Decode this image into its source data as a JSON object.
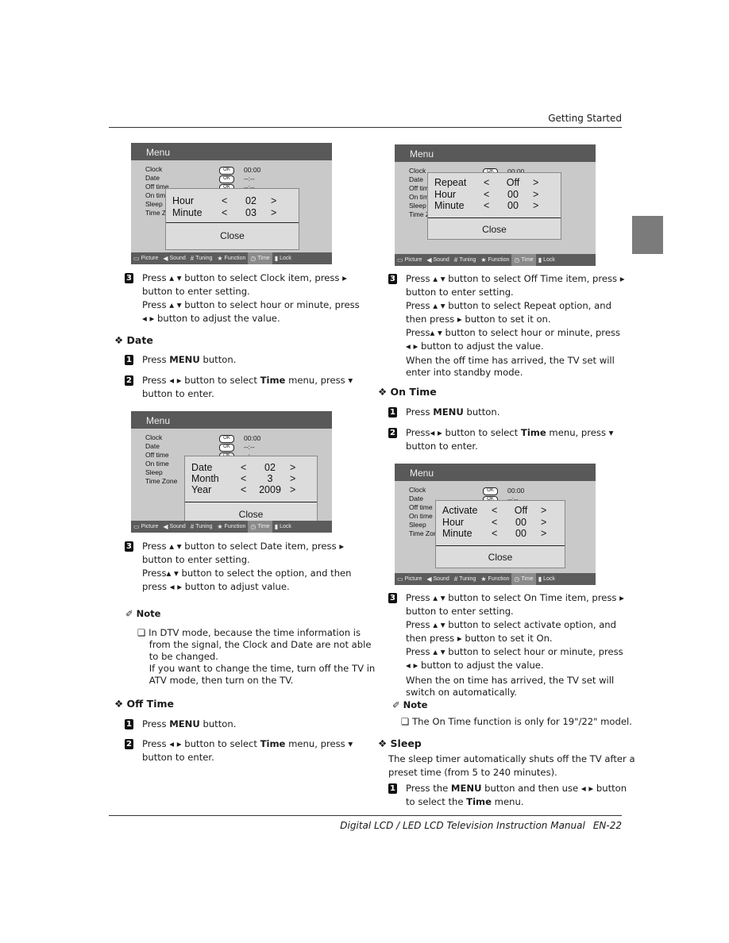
{
  "header": {
    "section": "Getting Started"
  },
  "footer": {
    "manual_title": "Digital LCD / LED LCD Television Instruction Manual",
    "page": "EN-22"
  },
  "menus": [
    {
      "title": "Menu",
      "items": [
        "Clock",
        "Date",
        "Off time",
        "On time",
        "Sleep",
        "Time Zone"
      ],
      "values": [
        "00:00",
        "--:--",
        "--:--"
      ],
      "ok_label": "OK",
      "popup": [
        {
          "label": "Hour",
          "value": "02"
        },
        {
          "label": "Minute",
          "value": "03"
        }
      ],
      "close": "Close",
      "tabs": [
        {
          "label": "Picture",
          "icon": "picture-icon"
        },
        {
          "label": "Sound",
          "icon": "speaker-icon"
        },
        {
          "label": "Tuning",
          "icon": "grid-icon"
        },
        {
          "label": "Function",
          "icon": "star-icon"
        },
        {
          "label": "Time",
          "icon": "clock-icon",
          "selected": true
        },
        {
          "label": "Lock",
          "icon": "lock-icon"
        }
      ]
    },
    {
      "title": "Menu",
      "items": [
        "Clock",
        "Date",
        "Off time",
        "On time",
        "Sleep",
        "Time Zone"
      ],
      "values": [
        "00:00",
        "--:--",
        "--:--"
      ],
      "ok_label": "OK",
      "popup": [
        {
          "label": "Date",
          "value": "02"
        },
        {
          "label": "Month",
          "value": "3"
        },
        {
          "label": "Year",
          "value": "2009"
        }
      ],
      "close": "Close",
      "tabs": [
        {
          "label": "Picture",
          "icon": "picture-icon"
        },
        {
          "label": "Sound",
          "icon": "speaker-icon"
        },
        {
          "label": "Tuning",
          "icon": "grid-icon"
        },
        {
          "label": "Function",
          "icon": "star-icon"
        },
        {
          "label": "Time",
          "icon": "clock-icon",
          "selected": true
        },
        {
          "label": "Lock",
          "icon": "lock-icon"
        }
      ]
    },
    {
      "title": "Menu",
      "items": [
        "Clock",
        "Date",
        "Off time",
        "On time",
        "Sleep",
        "Time Zone"
      ],
      "values": [
        "00:00"
      ],
      "ok_label": "OK",
      "popup": [
        {
          "label": "Repeat",
          "value": "Off"
        },
        {
          "label": "Hour",
          "value": "00"
        },
        {
          "label": "Minute",
          "value": "00"
        }
      ],
      "close": "Close",
      "tabs": [
        {
          "label": "Picture",
          "icon": "picture-icon"
        },
        {
          "label": "Sound",
          "icon": "speaker-icon"
        },
        {
          "label": "Tuning",
          "icon": "grid-icon"
        },
        {
          "label": "Function",
          "icon": "star-icon"
        },
        {
          "label": "Time",
          "icon": "clock-icon",
          "selected": true
        },
        {
          "label": "Lock",
          "icon": "lock-icon"
        }
      ]
    },
    {
      "title": "Menu",
      "items": [
        "Clock",
        "Date",
        "Off time",
        "On time",
        "Sleep",
        "Time Zone"
      ],
      "values": [
        "00:00",
        "--:--"
      ],
      "ok_label": "OK",
      "popup": [
        {
          "label": "Activate",
          "value": "Off"
        },
        {
          "label": "Hour",
          "value": "00"
        },
        {
          "label": "Minute",
          "value": "00"
        }
      ],
      "close": "Close",
      "tabs": [
        {
          "label": "Picture",
          "icon": "picture-icon"
        },
        {
          "label": "Sound",
          "icon": "speaker-icon"
        },
        {
          "label": "Tuning",
          "icon": "grid-icon"
        },
        {
          "label": "Function",
          "icon": "star-icon"
        },
        {
          "label": "Time",
          "icon": "clock-icon",
          "selected": true
        },
        {
          "label": "Lock",
          "icon": "lock-icon"
        }
      ]
    }
  ],
  "left": {
    "clock_step3": {
      "num": "3",
      "lines": [
        [
          "Press ▴ ▾ button to select Clock item, press ▸"
        ],
        [
          "button to enter setting."
        ],
        [
          "Press ▴ ▾ button to select hour or minute, press"
        ],
        [
          "◂ ▸ button to adjust the value."
        ]
      ]
    },
    "date_heading": "❖ Date",
    "date_step1": {
      "num": "1",
      "lines": [
        [
          "Press ",
          {
            "b": "MENU"
          },
          " button."
        ]
      ]
    },
    "date_step2": {
      "num": "2",
      "lines": [
        [
          "Press ◂ ▸ button to select ",
          {
            "b": "Time"
          },
          " menu, press ▾"
        ],
        [
          "button to enter."
        ]
      ]
    },
    "date_step3": {
      "num": "3",
      "lines": [
        [
          "Press ▴ ▾ button to select Date item, press ▸"
        ],
        [
          "button to enter setting."
        ],
        [
          "Press▴ ▾ button to select the option, and then"
        ],
        [
          "press ◂ ▸ button to adjust value."
        ]
      ]
    },
    "note_heading": "✐ Note",
    "note": {
      "lines": [
        [
          "❏ In DTV mode, because the time information is"
        ],
        [
          "    from the signal, the Clock and Date are not able"
        ],
        [
          "    to be changed."
        ],
        [
          "    If you want to change the time, turn off the TV in"
        ],
        [
          "    ATV mode, then turn on the TV."
        ]
      ]
    },
    "offtime_heading": "❖ Off Time",
    "offtime_step1": {
      "num": "1",
      "lines": [
        [
          "Press ",
          {
            "b": "MENU"
          },
          " button."
        ]
      ]
    },
    "offtime_step2": {
      "num": "2",
      "lines": [
        [
          "Press ◂ ▸ button to select ",
          {
            "b": "Time"
          },
          " menu, press ▾"
        ],
        [
          "button to enter."
        ]
      ]
    }
  },
  "right": {
    "offtime_step3": {
      "num": "3",
      "lines": [
        [
          "Press ▴ ▾ button to select Off Time item, press ▸"
        ],
        [
          "button to enter setting."
        ],
        [
          "Press ▴ ▾ button to select Repeat option, and"
        ],
        [
          "then press ▸ button to set it on."
        ],
        [
          "Press▴ ▾ button to select hour or minute, press"
        ],
        [
          "◂ ▸ button to adjust the value."
        ]
      ]
    },
    "offtime_result": {
      "lines": [
        [
          "When the off time has arrived, the TV set will"
        ],
        [
          "enter into standby mode."
        ]
      ]
    },
    "ontime_heading": "❖ On Time",
    "ontime_step1": {
      "num": "1",
      "lines": [
        [
          "Press ",
          {
            "b": "MENU"
          },
          " button."
        ]
      ]
    },
    "ontime_step2": {
      "num": "2",
      "lines": [
        [
          "Press◂ ▸ button to select ",
          {
            "b": "Time"
          },
          " menu, press ▾"
        ],
        [
          "button to enter."
        ]
      ]
    },
    "ontime_step3": {
      "num": "3",
      "lines": [
        [
          "Press ▴ ▾ button to select On Time item, press ▸"
        ],
        [
          "button to enter setting."
        ],
        [
          "Press ▴ ▾ button to select activate option, and"
        ],
        [
          "then press ▸ button to set it On."
        ],
        [
          "Press ▴ ▾ button to select hour or minute, press"
        ],
        [
          "◂ ▸ button to adjust the value."
        ]
      ]
    },
    "ontime_result": {
      "lines": [
        [
          "When the on time has arrived, the TV set will"
        ],
        [
          "switch on automatically."
        ]
      ]
    },
    "note_heading": "✐ Note",
    "note": {
      "lines": [
        [
          "❏ The On Time function is only for 19\"/22\" model."
        ]
      ]
    },
    "sleep_heading": "❖ Sleep",
    "sleep_intro": {
      "lines": [
        [
          "The sleep timer automatically shuts off the TV after a"
        ],
        [
          "preset time (from 5 to 240 minutes)."
        ]
      ]
    },
    "sleep_step1": {
      "num": "1",
      "lines": [
        [
          "Press the ",
          {
            "b": "MENU"
          },
          " button and then use ◂ ▸ button"
        ],
        [
          "to select the ",
          {
            "b": "Time"
          },
          " menu."
        ]
      ]
    }
  }
}
